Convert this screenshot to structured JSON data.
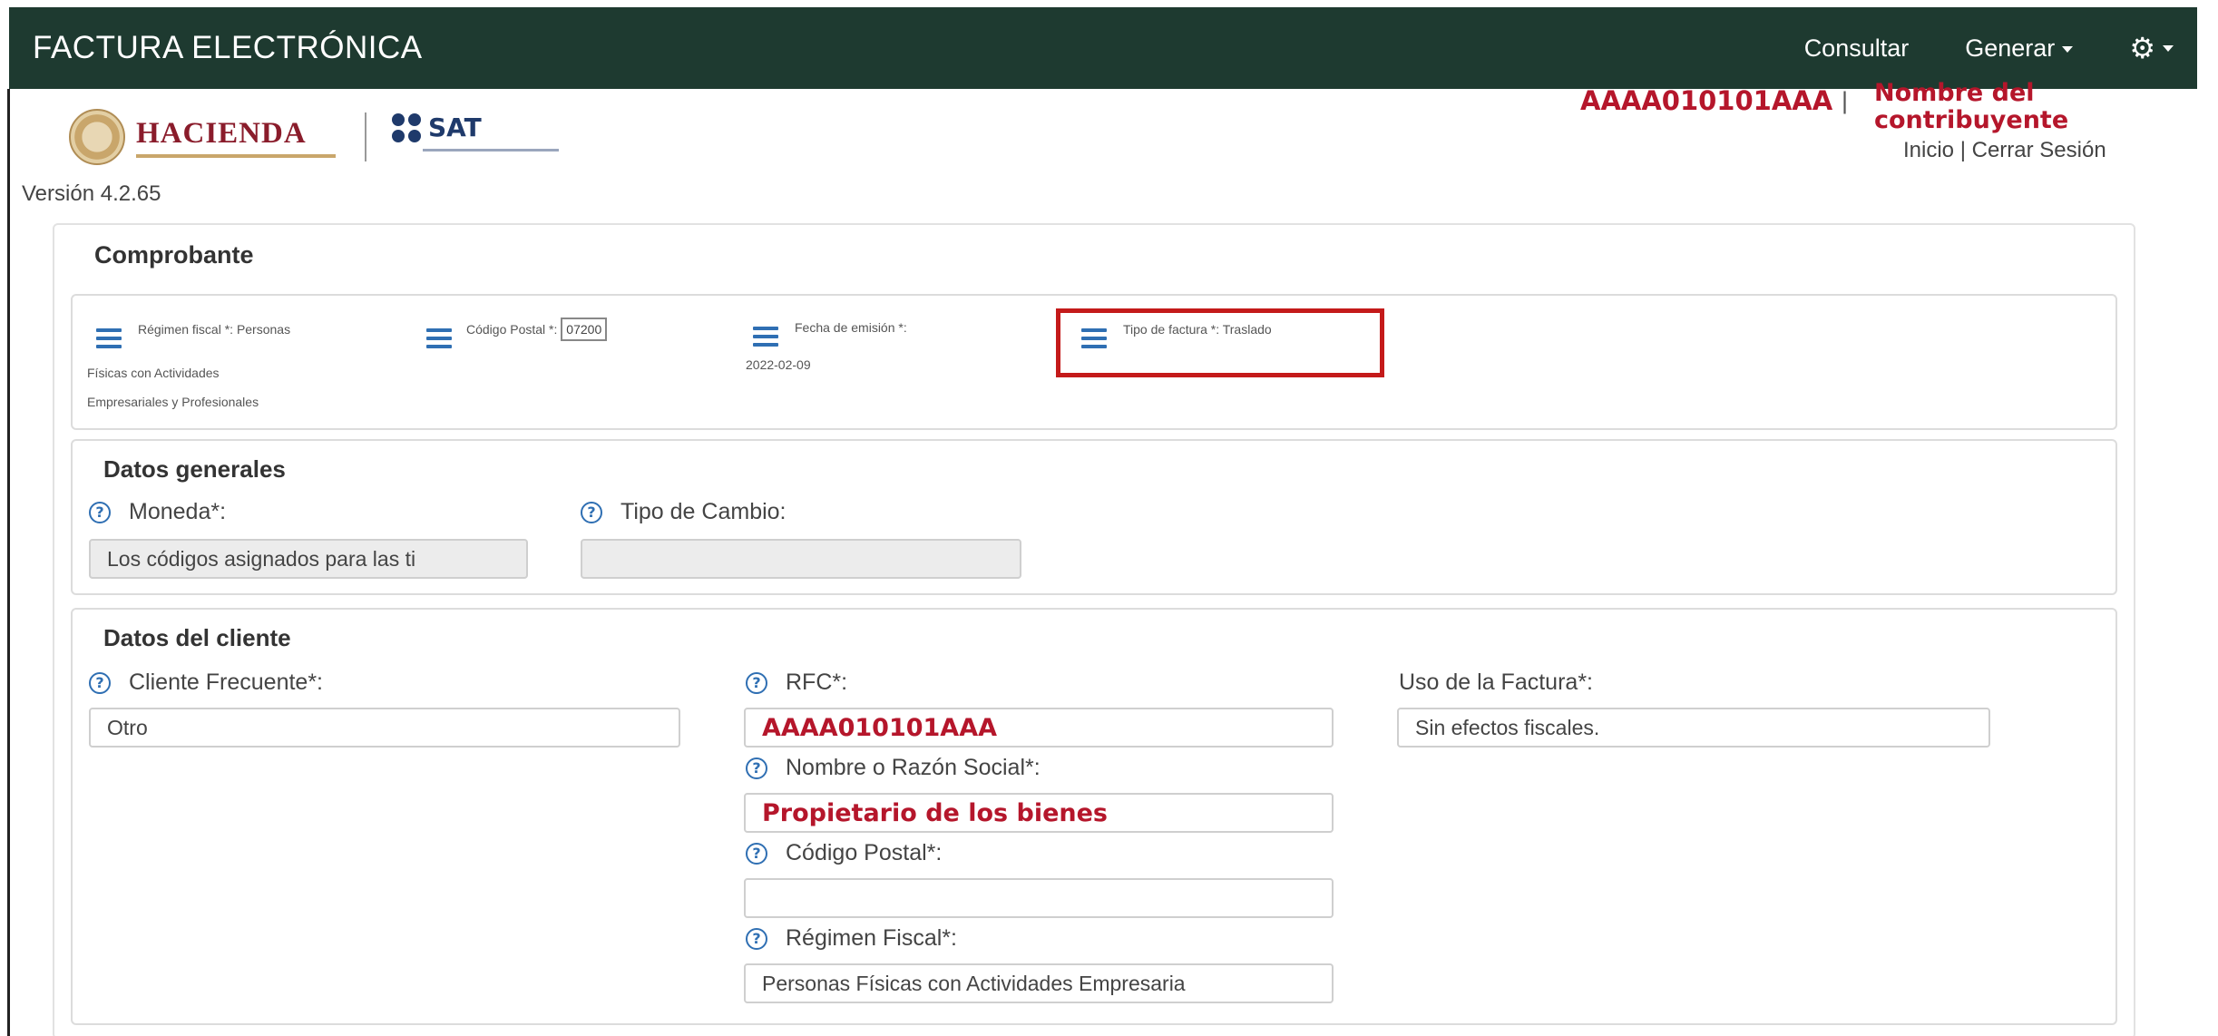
{
  "navbar": {
    "title": "FACTURA ELECTRÓNICA",
    "consultar": "Consultar",
    "generar": "Generar",
    "settings_icon": "gear-icon"
  },
  "logos": {
    "hacienda": "HACIENDA",
    "sat": "SAT"
  },
  "user": {
    "rfc": "AAAA010101AAA",
    "separator": "|",
    "name": "Nombre del contribuyente",
    "inicio": "Inicio",
    "link_sep": " | ",
    "cerrar": "Cerrar Sesión"
  },
  "version": "Versión 4.2.65",
  "comprobante": {
    "title": "Comprobante",
    "regimen_label": "Régimen fiscal *:",
    "regimen_value_1": "Personas",
    "regimen_value_2": "Físicas con Actividades",
    "regimen_value_3": "Empresariales y Profesionales",
    "codigo_label": "Código Postal *:",
    "codigo_value": "07200",
    "fecha_label": "Fecha de emisión *:",
    "fecha_value": "2022-02-09",
    "tipo_label": "Tipo de factura *:",
    "tipo_value": "Traslado"
  },
  "datos_generales": {
    "title": "Datos generales",
    "moneda_label": "Moneda*:",
    "moneda_value": "Los códigos asignados para las ti",
    "tipo_cambio_label": "Tipo de Cambio:",
    "tipo_cambio_value": ""
  },
  "datos_cliente": {
    "title": "Datos del cliente",
    "cliente_frecuente_label": "Cliente Frecuente*:",
    "cliente_frecuente_value": "Otro",
    "rfc_label": "RFC*:",
    "rfc_value": "AAAA010101AAA",
    "uso_label": "Uso de la Factura*:",
    "uso_value": "Sin efectos fiscales.",
    "nombre_label": "Nombre o Razón Social*:",
    "nombre_value": "Propietario de los bienes",
    "cp_label": "Código Postal*:",
    "cp_value": "",
    "regimen_label": "Régimen Fiscal*:",
    "regimen_value": "Personas Físicas con Actividades Empresaria"
  },
  "colors": {
    "navbar": "#1e3a30",
    "accent_red": "#b5162b",
    "help_blue": "#2f6fb3",
    "highlight_border": "#c41a1a"
  }
}
